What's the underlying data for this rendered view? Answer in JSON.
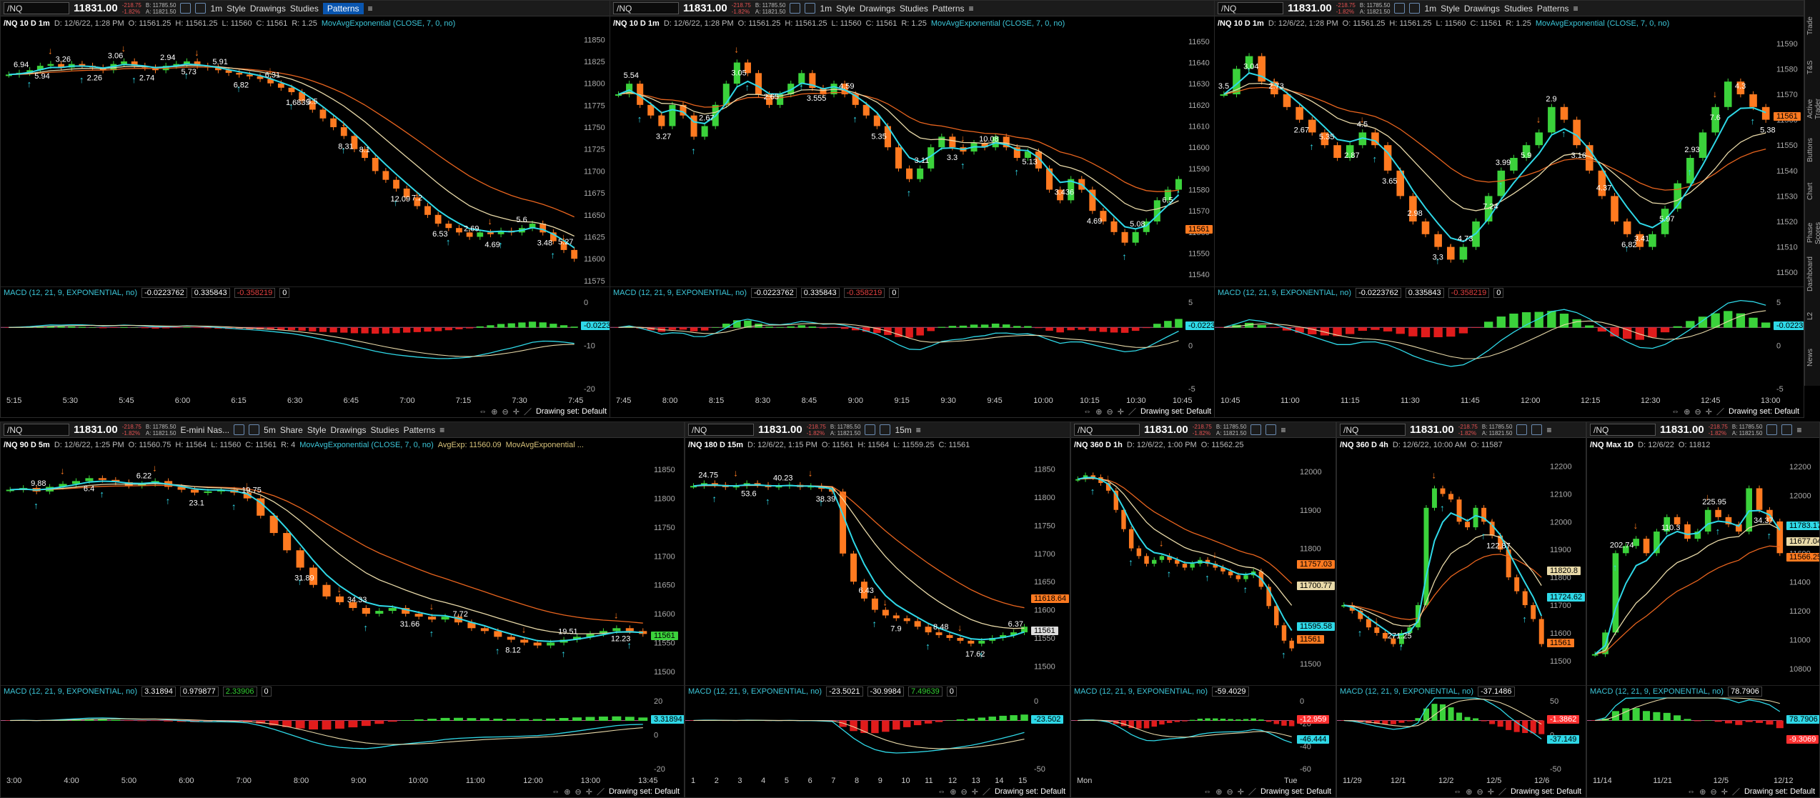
{
  "app": {
    "right_tabs": [
      "Trade",
      "T&S",
      "Active Trader",
      "Buttons",
      "Chart",
      "Phase Scores",
      "Dashboard",
      "L2",
      "News"
    ],
    "drawing_set": "Drawing set: Default"
  },
  "colors": {
    "up": "#3bd23b",
    "down": "#ff7a20",
    "ema_fast": "#2fd9e8",
    "ema_mid": "#e8d9a8",
    "ema_slow": "#e8641e",
    "macd_up": "#3bd23b",
    "macd_dn": "#e01c1c",
    "bg": "#000000",
    "grid": "#1c1c1c"
  },
  "panels": [
    {
      "symbol": "/NQ",
      "price": "11831.00",
      "chg": "-218.75",
      "pct": "-1.82%",
      "bid": "B: 11785.50",
      "ask": "A: 11821.50",
      "tools": [
        "1m",
        "Style",
        "Drawings",
        "Studies",
        "Patterns"
      ],
      "info": {
        "title": "/NQ 10 D 1m",
        "date": "D: 12/6/22, 1:28 PM",
        "o": "O: 11561.25",
        "h": "H: 11561.25",
        "l": "L: 11560",
        "c": "C: 11561",
        "r": "R: 1.25",
        "study": "MovAvgExponential (CLOSE, 7, 0, no)"
      },
      "macd": {
        "label": "MACD (12, 21, 9, EXPONENTIAL, no)",
        "v1": "-0.0223762",
        "v2": "0.335843",
        "v3": "-0.358219",
        "v4": "0"
      },
      "ylabels": [
        "11850",
        "11825",
        "11800",
        "11775",
        "11750",
        "11725",
        "11700",
        "11675",
        "11650",
        "11625",
        "11600",
        "11575"
      ],
      "macd_y": [
        "0",
        "-10",
        "-20"
      ],
      "xlabels": [
        "5:15",
        "5:30",
        "5:45",
        "6:00",
        "6:15",
        "6:30",
        "6:45",
        "7:00",
        "7:15",
        "7:30",
        "7:45"
      ],
      "price_tags": [],
      "macd_tag": "-0.0223",
      "annotations": [
        "6.94",
        "5.94",
        "3.26",
        "2.26",
        "3.06",
        "2.74",
        "2.94",
        "5.73",
        "5.91",
        "6.82",
        "6.31",
        "1.6835",
        "3.5",
        "8.31",
        "8.1",
        "12.09",
        "7.2",
        "6.53",
        "2.69",
        "4.69",
        "5.6",
        "3.48",
        "5.27"
      ],
      "chart_data": {
        "type": "candlestick",
        "ylim": [
          11570,
          11860
        ],
        "path": [
          11810,
          11812,
          11815,
          11820,
          11822,
          11818,
          11822,
          11820,
          11818,
          11815,
          11822,
          11825,
          11820,
          11818,
          11815,
          11820,
          11822,
          11825,
          11820,
          11818,
          11815,
          11812,
          11810,
          11808,
          11805,
          11800,
          11795,
          11790,
          11780,
          11770,
          11760,
          11750,
          11740,
          11725,
          11715,
          11700,
          11690,
          11680,
          11670,
          11660,
          11650,
          11640,
          11635,
          11630,
          11625,
          11630,
          11628,
          11632,
          11630,
          11635,
          11640,
          11630,
          11620,
          11610,
          11600
        ]
      }
    },
    {
      "symbol": "/NQ",
      "price": "11831.00",
      "chg": "-218.75",
      "pct": "-1.82%",
      "bid": "B: 11785.50",
      "ask": "A: 11821.50",
      "tools": [
        "1m",
        "Style",
        "Drawings",
        "Studies",
        "Patterns"
      ],
      "info": {
        "title": "/NQ 10 D 1m",
        "date": "D: 12/6/22, 1:28 PM",
        "o": "O: 11561.25",
        "h": "H: 11561.25",
        "l": "L: 11560",
        "c": "C: 11561",
        "r": "R: 1.25",
        "study": "MovAvgExponential (CLOSE, 7, 0, no)"
      },
      "macd": {
        "label": "MACD (12, 21, 9, EXPONENTIAL, no)",
        "v1": "-0.0223762",
        "v2": "0.335843",
        "v3": "-0.358219",
        "v4": "0"
      },
      "ylabels": [
        "11650",
        "11640",
        "11630",
        "11620",
        "11610",
        "11600",
        "11590",
        "11580",
        "11570",
        "11560",
        "11550",
        "11540"
      ],
      "macd_y": [
        "5",
        "0",
        "-5"
      ],
      "xlabels": [
        "7:45",
        "8:00",
        "8:15",
        "8:30",
        "8:45",
        "9:00",
        "9:15",
        "9:30",
        "9:45",
        "10:00",
        "10:15",
        "10:30",
        "10:45"
      ],
      "price_tags": [
        {
          "t": "11561",
          "c": "#ff7a20"
        }
      ],
      "macd_tag": "-0.0223",
      "annotations": [
        "5.54",
        "3.27",
        "2.67",
        "3.05",
        "2.65",
        "3.555",
        "4.59",
        "5.35",
        "3.11",
        "3.3",
        "10.08",
        "5.13",
        "3.436",
        "4.69",
        "5.08",
        "6.5"
      ],
      "chart_data": {
        "type": "candlestick",
        "ylim": [
          11535,
          11655
        ],
        "path": [
          11625,
          11630,
          11620,
          11615,
          11610,
          11620,
          11615,
          11605,
          11610,
          11620,
          11630,
          11640,
          11635,
          11625,
          11620,
          11625,
          11630,
          11635,
          11628,
          11625,
          11630,
          11625,
          11620,
          11615,
          11610,
          11600,
          11590,
          11585,
          11590,
          11600,
          11605,
          11600,
          11598,
          11602,
          11600,
          11605,
          11600,
          11595,
          11598,
          11590,
          11580,
          11575,
          11585,
          11580,
          11570,
          11565,
          11560,
          11555,
          11560,
          11565,
          11575,
          11580,
          11585
        ]
      }
    },
    {
      "symbol": "/NQ",
      "price": "11831.00",
      "chg": "-218.75",
      "pct": "-1.82%",
      "bid": "B: 11785.50",
      "ask": "A: 11821.50",
      "tools": [
        "1m",
        "Style",
        "Drawings",
        "Studies",
        "Patterns"
      ],
      "info": {
        "title": "/NQ 10 D 1m",
        "date": "D: 12/6/22, 1:28 PM",
        "o": "O: 11561.25",
        "h": "H: 11561.25",
        "l": "L: 11560",
        "c": "C: 11561",
        "r": "R: 1.25",
        "study": "MovAvgExponential (CLOSE, 7, 0, no)"
      },
      "macd": {
        "label": "MACD (12, 21, 9, EXPONENTIAL, no)",
        "v1": "-0.0223762",
        "v2": "0.335843",
        "v3": "-0.358219",
        "v4": "0"
      },
      "ylabels": [
        "11590",
        "11580",
        "11570",
        "11560",
        "11550",
        "11540",
        "11530",
        "11520",
        "11510",
        "11500"
      ],
      "macd_y": [
        "5",
        "0",
        "-5"
      ],
      "xlabels": [
        "10:45",
        "11:00",
        "11:15",
        "11:30",
        "11:45",
        "12:00",
        "12:15",
        "12:30",
        "12:45",
        "13:00"
      ],
      "price_tags": [
        {
          "t": "11561",
          "c": "#ff7a20"
        }
      ],
      "macd_tag": "-0.0223",
      "annotations": [
        "3.5",
        "3.04",
        "2.73",
        "2.67",
        "5.35",
        "2.87",
        "4.5",
        "3.65",
        "2.98",
        "3.3",
        "4.73",
        "7.24",
        "3.99",
        "5.9",
        "2.9",
        "3.16",
        "4.37",
        "6.82",
        "3.41",
        "5.97",
        "2.93",
        "7.6",
        "4.3",
        "5.38"
      ],
      "chart_data": {
        "type": "candlestick",
        "ylim": [
          11495,
          11595
        ],
        "path": [
          11570,
          11580,
          11585,
          11575,
          11570,
          11565,
          11560,
          11555,
          11550,
          11545,
          11550,
          11555,
          11550,
          11540,
          11530,
          11520,
          11515,
          11510,
          11505,
          11510,
          11520,
          11530,
          11540,
          11545,
          11550,
          11555,
          11565,
          11560,
          11550,
          11540,
          11530,
          11520,
          11515,
          11510,
          11515,
          11525,
          11535,
          11545,
          11555,
          11565,
          11575,
          11570,
          11565,
          11560
        ]
      }
    },
    {
      "symbol": "/NQ",
      "price": "11831.00",
      "chg": "-218.75",
      "pct": "-1.82%",
      "bid": "B: 11785.50",
      "ask": "A: 11821.50",
      "label2": "E-mini Nas...",
      "tools": [
        "Share",
        "Style",
        "Drawings",
        "Studies",
        "Patterns"
      ],
      "tf": "5m",
      "info": {
        "title": "/NQ 90 D 5m",
        "date": "D: 12/6/22, 1:25 PM",
        "o": "O: 11560.75",
        "h": "H: 11564",
        "l": "L: 11560",
        "c": "C: 11561",
        "r": "R: 4",
        "study": "MovAvgExponential (CLOSE, 7, 0, no)",
        "study2": "AvgExp: 11560.09",
        "study3": "MovAvgExponential ..."
      },
      "macd": {
        "label": "MACD (12, 21, 9, EXPONENTIAL, no)",
        "v1": "3.31894",
        "v2": "0.979877",
        "v3": "2.33906",
        "v4": "0"
      },
      "ylabels": [
        "11850",
        "11800",
        "11750",
        "11700",
        "11650",
        "11600",
        "11550",
        "11500"
      ],
      "macd_y": [
        "20",
        "0",
        "-20"
      ],
      "xlabels": [
        "3:00",
        "4:00",
        "5:00",
        "6:00",
        "7:00",
        "8:00",
        "9:00",
        "10:00",
        "11:00",
        "12:00",
        "13:00",
        "13:45"
      ],
      "price_tags": [
        {
          "t": "11561",
          "c": "#3bd23b"
        }
      ],
      "macd_tag": "3.31894",
      "annotations": [
        "9.88",
        "6.4",
        "6.22",
        "23.1",
        "19.75",
        "31.89",
        "34.33",
        "31.66",
        "7.72",
        "8.12",
        "19.51",
        "12.23"
      ],
      "chart_data": {
        "type": "candlestick",
        "ylim": [
          11480,
          11880
        ],
        "path": [
          11815,
          11818,
          11812,
          11820,
          11825,
          11830,
          11835,
          11832,
          11828,
          11822,
          11825,
          11830,
          11820,
          11815,
          11810,
          11812,
          11815,
          11810,
          11800,
          11770,
          11740,
          11710,
          11680,
          11650,
          11630,
          11620,
          11610,
          11600,
          11605,
          11610,
          11600,
          11595,
          11590,
          11595,
          11585,
          11575,
          11570,
          11560,
          11555,
          11550,
          11545,
          11550,
          11555,
          11560,
          11565,
          11570,
          11575,
          11570,
          11565
        ]
      }
    },
    {
      "symbol": "/NQ",
      "price": "11831.00",
      "chg": "-218.75",
      "pct": "-1.82%",
      "bid": "B: 11785.50",
      "ask": "A: 11821.50",
      "tools": [],
      "tf": "15m",
      "info": {
        "title": "/NQ 180 D 15m",
        "date": "D: 12/6/22, 1:15 PM",
        "o": "O: 11561",
        "h": "H: 11564",
        "l": "L: 11559.25",
        "c": "C: 11561",
        "r": "",
        "study": ""
      },
      "macd": {
        "label": "MACD (12, 21, 9, EXPONENTIAL, no)",
        "v1": "-23.5021",
        "v2": "-30.9984",
        "v3": "7.49639",
        "v4": "0"
      },
      "ylabels": [
        "11850",
        "11800",
        "11750",
        "11700",
        "11650",
        "11600",
        "11550",
        "11500"
      ],
      "macd_y": [
        "0",
        "-50"
      ],
      "xlabels": [
        "1",
        "2",
        "3",
        "4",
        "5",
        "6",
        "7",
        "8",
        "9",
        "10",
        "11",
        "12",
        "13",
        "14",
        "15"
      ],
      "price_tags": [
        {
          "t": "11618.64",
          "c": "#ff7a20"
        },
        {
          "t": "11561",
          "c": "#dddddd"
        }
      ],
      "macd_tag": "-23.502",
      "annotations": [
        "24.75",
        "53.6",
        "40.23",
        "38.39",
        "6.43",
        "7.9",
        "8.48",
        "17.62",
        "6.37"
      ],
      "chart_data": {
        "type": "candlestick",
        "ylim": [
          11470,
          11880
        ],
        "path": [
          11820,
          11825,
          11822,
          11818,
          11820,
          11825,
          11822,
          11818,
          11820,
          11822,
          11818,
          11820,
          11815,
          11810,
          11700,
          11650,
          11620,
          11600,
          11590,
          11585,
          11580,
          11570,
          11560,
          11555,
          11550,
          11545,
          11540,
          11545,
          11550,
          11555,
          11560,
          11570
        ]
      }
    },
    {
      "symbol": "/NQ",
      "price": "11831.00",
      "chg": "-218.75",
      "pct": "-1.82%",
      "bid": "B: 11785.50",
      "ask": "A: 11821.50",
      "tools": [],
      "info": {
        "title": "/NQ 360 D 1h",
        "date": "D: 12/6/22, 1:00 PM",
        "o": "O: 11562.25",
        "h": "",
        "l": "",
        "c": "",
        "r": "",
        "study": ""
      },
      "macd": {
        "label": "MACD (12, 21, 9, EXPONENTIAL, no)",
        "v1": "-59.4029",
        "v2": "",
        "v3": "",
        "v4": ""
      },
      "ylabels": [
        "12000",
        "11900",
        "11800",
        "11700",
        "11600",
        "11500"
      ],
      "macd_y": [
        "0",
        "-20",
        "-40",
        "-60"
      ],
      "xlabels": [
        "Mon",
        "Tue"
      ],
      "price_tags": [
        {
          "t": "11757.03",
          "c": "#ff7a20"
        },
        {
          "t": "11700.77",
          "c": "#e8d9a8"
        },
        {
          "t": "11595.58",
          "c": "#2fd9e8"
        },
        {
          "t": "11561",
          "c": "#ff7a20"
        }
      ],
      "macd_tag": "-12.959",
      "macd_tag2": "-46.444",
      "annotations": [],
      "chart_data": {
        "type": "candlestick",
        "ylim": [
          11450,
          12050
        ],
        "path": [
          11980,
          11990,
          11985,
          11970,
          11950,
          11900,
          11850,
          11800,
          11780,
          11760,
          11770,
          11780,
          11770,
          11760,
          11750,
          11760,
          11770,
          11760,
          11750,
          11740,
          11730,
          11720,
          11730,
          11740,
          11700,
          11650,
          11600,
          11560,
          11540
        ]
      }
    },
    {
      "symbol": "/NQ",
      "price": "11831.00",
      "chg": "-218.75",
      "pct": "-1.82%",
      "bid": "B: 11785.50",
      "ask": "A: 11821.50",
      "tools": [],
      "info": {
        "title": "/NQ 360 D 4h",
        "date": "D: 12/6/22, 10:00 AM",
        "o": "O: 11587",
        "h": "",
        "l": "",
        "c": "",
        "r": "",
        "study": ""
      },
      "macd": {
        "label": "MACD (12, 21, 9, EXPONENTIAL, no)",
        "v1": "-37.1486",
        "v2": "",
        "v3": "",
        "v4": ""
      },
      "ylabels": [
        "12200",
        "12100",
        "12000",
        "11900",
        "11800",
        "11700",
        "11600",
        "11500"
      ],
      "macd_y": [
        "50",
        "0",
        "-50"
      ],
      "xlabels": [
        "11/29",
        "12/1",
        "12/2",
        "12/5",
        "12/6"
      ],
      "price_tags": [
        {
          "t": "11820.8",
          "c": "#e8d9a8"
        },
        {
          "t": "11724.62",
          "c": "#2fd9e8"
        },
        {
          "t": "11561",
          "c": "#ff7a20"
        }
      ],
      "macd_tag": "-1.3862",
      "macd_tag2": "-37.149",
      "annotations": [
        "271.25",
        "122.87"
      ],
      "chart_data": {
        "type": "candlestick",
        "ylim": [
          11420,
          12250
        ],
        "path": [
          11700,
          11680,
          11650,
          11620,
          11600,
          11580,
          11560,
          11600,
          11620,
          11700,
          12050,
          12120,
          12100,
          12080,
          12000,
          11980,
          12050,
          12000,
          11950,
          11900,
          11800,
          11750,
          11700,
          11650,
          11560
        ]
      }
    },
    {
      "symbol": "/NQ",
      "price": "11831.00",
      "chg": "-218.75",
      "pct": "-1.82%",
      "bid": "B: 11785.50",
      "ask": "A: 11821.50",
      "tools": [],
      "info": {
        "title": "/NQ Max 1D",
        "date": "D: 12/6/22",
        "o": "O: 11812",
        "h": "",
        "l": "",
        "c": "",
        "r": "",
        "study": ""
      },
      "macd": {
        "label": "MACD (12, 21, 9, EXPONENTIAL, no)",
        "v1": "78.7906",
        "v2": "",
        "v3": "",
        "v4": ""
      },
      "ylabels": [
        "12200",
        "12000",
        "11800",
        "11600",
        "11400",
        "11200",
        "11000",
        "10800"
      ],
      "macd_y": [],
      "xlabels": [
        "11/14",
        "11/21",
        "12/5",
        "12/12"
      ],
      "price_tags": [
        {
          "t": "11783.17",
          "c": "#2fd9e8"
        },
        {
          "t": "11677.04",
          "c": "#e8d9a8"
        },
        {
          "t": "11566.25",
          "c": "#ff7a20"
        }
      ],
      "macd_tag": "78.7906",
      "macd_tag2": "-9.3069",
      "annotations": [
        "202.74",
        "110.3",
        "225.95",
        "34.37"
      ],
      "chart_data": {
        "type": "candlestick",
        "ylim": [
          10700,
          12300
        ],
        "path": [
          10900,
          11050,
          11600,
          11650,
          11700,
          11600,
          11750,
          11850,
          11800,
          11700,
          11750,
          11900,
          11850,
          11800,
          11750,
          12050,
          11900,
          11820,
          11600
        ]
      }
    }
  ]
}
